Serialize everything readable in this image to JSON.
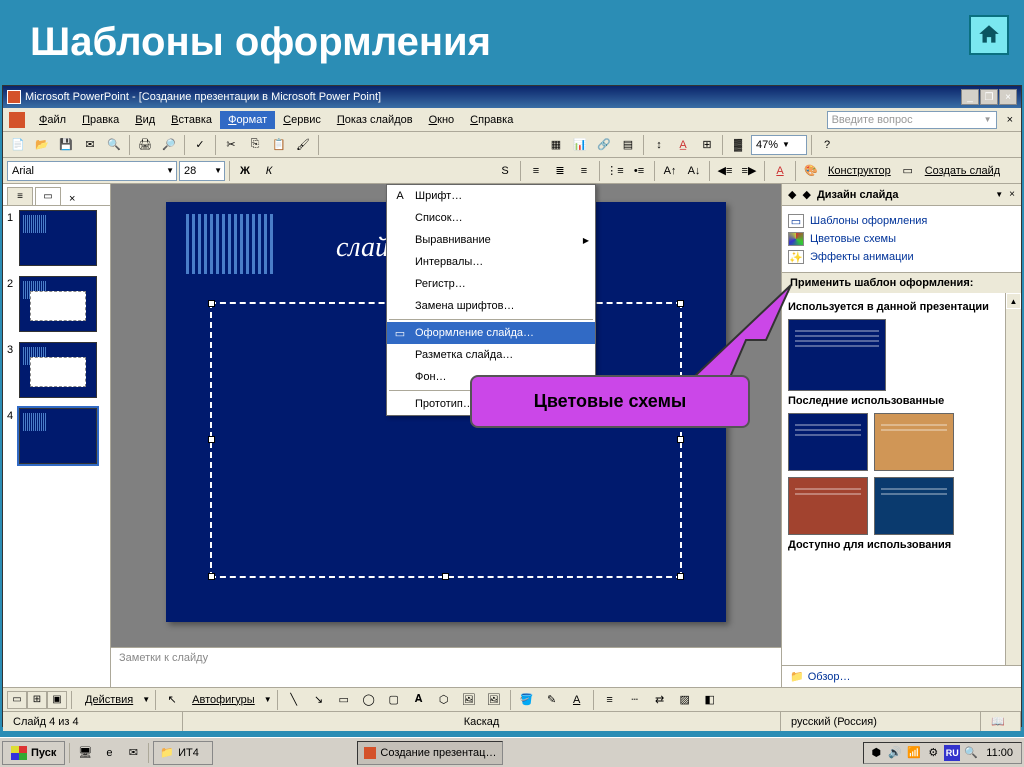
{
  "page": {
    "title": "Шаблоны оформления"
  },
  "window": {
    "title": "Microsoft PowerPoint - [Создание презентации в Microsoft Power Point]"
  },
  "menubar": {
    "file": "Файл",
    "edit": "Правка",
    "view": "Вид",
    "insert": "Вставка",
    "format": "Формат",
    "tools": "Сервис",
    "slideshow": "Показ слайдов",
    "window": "Окно",
    "help": "Справка",
    "help_placeholder": "Введите вопрос"
  },
  "format_menu": {
    "font": "Шрифт…",
    "list": "Список…",
    "align": "Выравнивание",
    "spacing": "Интервалы…",
    "register": "Регистр…",
    "replace_fonts": "Замена шрифтов…",
    "slide_design": "Оформление слайда…",
    "slide_layout": "Разметка слайда…",
    "background": "Фон…",
    "prototype": "Прототип…"
  },
  "toolbar": {
    "zoom": "47%"
  },
  "toolbar2": {
    "font": "Arial",
    "size": "28",
    "constructor": "Конструктор",
    "new_slide": "Создать слайд"
  },
  "slide_panel": {
    "nums": [
      "1",
      "2",
      "3",
      "4"
    ]
  },
  "slide": {
    "title_fragment": "слайда"
  },
  "notes": {
    "placeholder": "Заметки к слайду"
  },
  "callout": {
    "text": "Цветовые схемы"
  },
  "task_pane": {
    "title": "Дизайн слайда",
    "link_templates": "Шаблоны оформления",
    "link_colors": "Цветовые схемы",
    "link_anim": "Эффекты анимации",
    "apply": "Применить шаблон оформления:",
    "section_used": "Используется в данной презентации",
    "section_recent": "Последние использованные",
    "section_avail": "Доступно для использования",
    "browse": "Обзор…"
  },
  "draw_toolbar": {
    "actions": "Действия",
    "autoshapes": "Автофигуры"
  },
  "statusbar": {
    "slide_of": "Слайд 4 из 4",
    "layout": "Каскад",
    "lang": "русский (Россия)"
  },
  "taskbar": {
    "start": "Пуск",
    "folder": "ИТ4",
    "app": "Создание презентац…",
    "lang": "RU",
    "time": "11:00"
  }
}
